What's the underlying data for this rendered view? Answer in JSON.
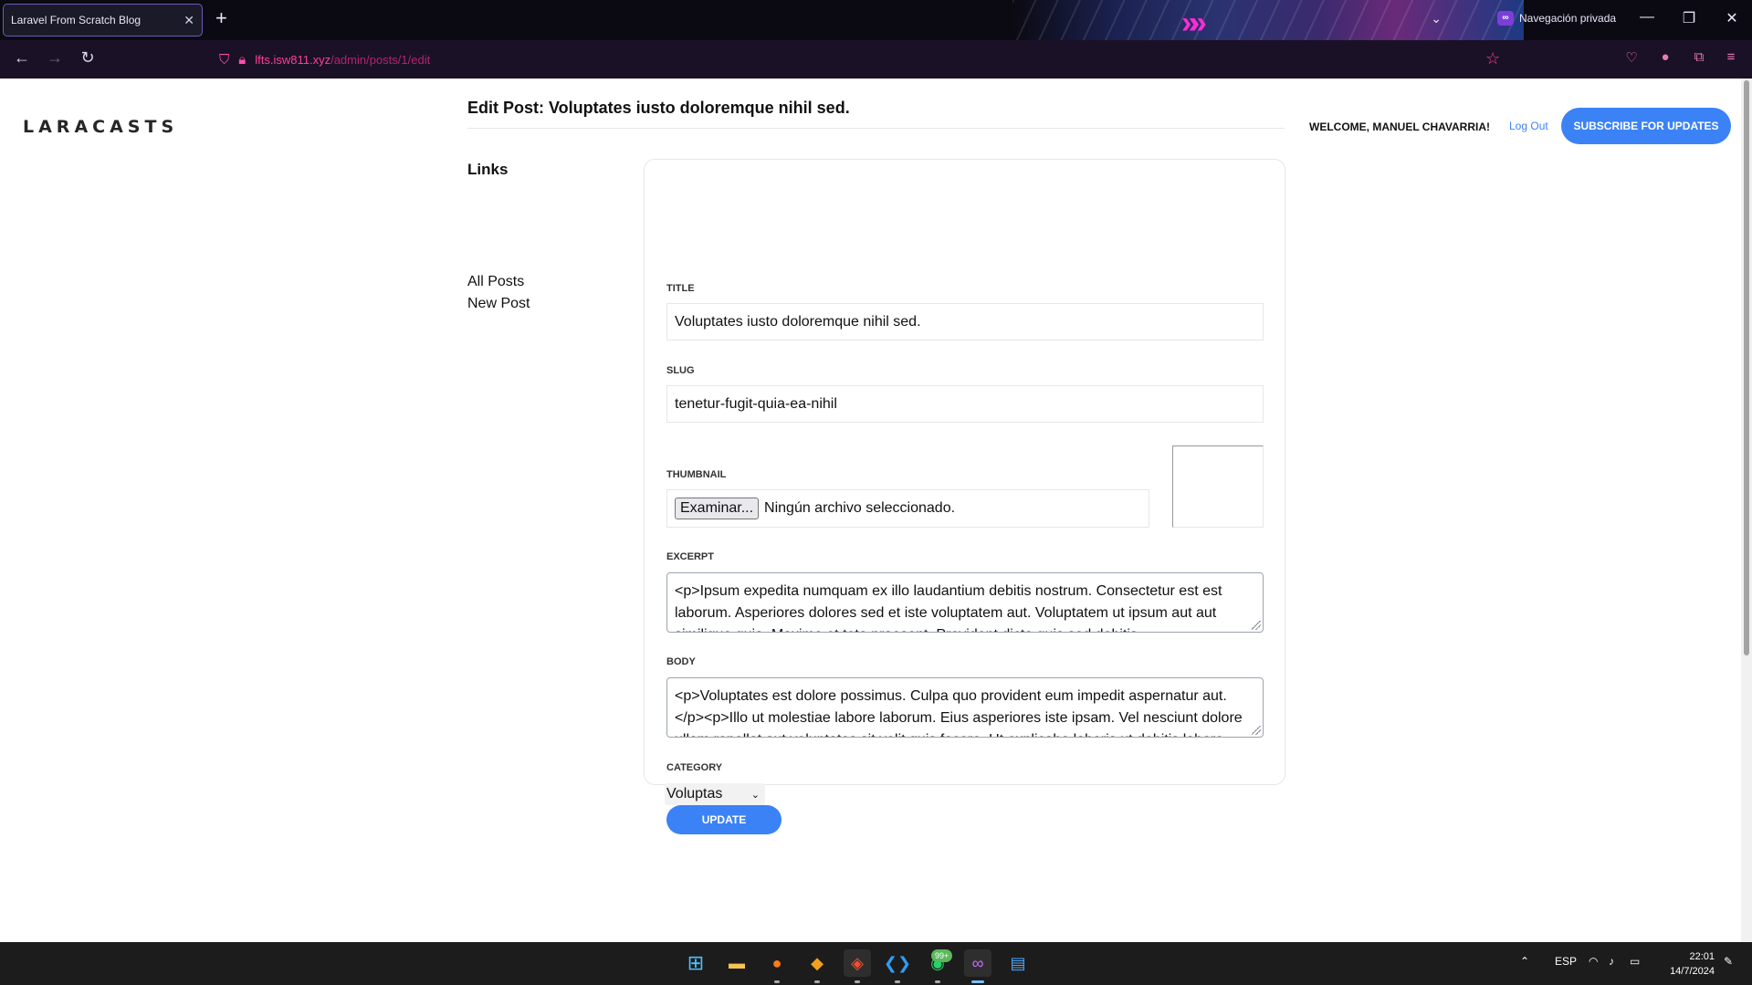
{
  "browser": {
    "tab_title": "Laravel From Scratch Blog",
    "tab_close": "✕",
    "new_tab": "+",
    "private_label": "Navegación privada",
    "url_host": "lfts.isw811.xyz",
    "url_path": "/admin/posts/1/edit",
    "icons": [
      "back-arrow-icon",
      "forward-arrow-icon",
      "reload-icon",
      "shield-icon",
      "lock-icon",
      "bookmark-star-icon",
      "pocket-icon",
      "account-icon",
      "extensions-icon",
      "menu-icon"
    ]
  },
  "header": {
    "logo": "LARACASTS",
    "welcome": "Welcome, Manuel Chavarria!",
    "logout": "Log Out",
    "subscribe": "Subscribe for Updates"
  },
  "main": {
    "title": "Edit Post: Voluptates iusto doloremque nihil sed.",
    "sidebar": {
      "heading": "Links",
      "links": [
        "All Posts",
        "New Post"
      ]
    },
    "form": {
      "title_label": "Title",
      "title_value": "Voluptates iusto doloremque nihil sed.",
      "slug_label": "Slug",
      "slug_value": "tenetur-fugit-quia-ea-nihil",
      "thumbnail_label": "Thumbnail",
      "file_button": "Examinar...",
      "file_status": "Ningún archivo seleccionado.",
      "excerpt_label": "Excerpt",
      "excerpt_value": "<p>Ipsum expedita numquam ex illo laudantium debitis nostrum. Consectetur est est laborum. Asperiores dolores sed et iste voluptatem aut. Voluptatem ut ipsum aut aut similique quia. Maxime et tota praesent. Provident dicta quis sed debitis.",
      "body_label": "Body",
      "body_value": "<p>Voluptates est dolore possimus. Culpa quo provident eum impedit aspernatur aut.</p><p>Illo ut molestiae labore laborum. Eius asperiores iste ipsam. Vel nesciunt dolore ullam repellat aut voluptates sit velit quis facere. Ut explicabo laboris ut debitis labore.",
      "category_label": "Category",
      "category_value": "Voluptas",
      "submit": "Update"
    }
  },
  "taskbar": {
    "apps": [
      "windows-start-icon",
      "file-explorer-icon",
      "firefox-icon",
      "app-icon",
      "git-icon",
      "vscode-icon",
      "whatsapp-icon",
      "firefox-private-icon",
      "notepad-icon"
    ],
    "badge": "99+",
    "language": "ESP",
    "time": "22:01",
    "date": "14/7/2024"
  },
  "colors": {
    "accent": "#3b82f6",
    "chrome_bg": "#0b0a12",
    "url_pink": "#ff3d9a"
  }
}
